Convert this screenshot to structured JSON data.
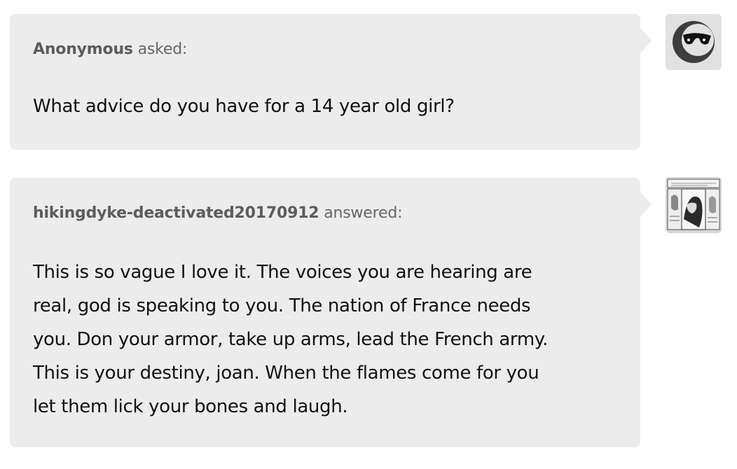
{
  "question": {
    "asker_name": "Anonymous",
    "asker_verb": " asked:",
    "text": "What advice do you have for a 14 year old girl?",
    "avatar_icon": "sunglasses-face-icon"
  },
  "answer": {
    "answerer_name": "hikingdyke-deactivated20170912",
    "answerer_verb": " answered:",
    "lines": [
      "This is so vague I love it. The voices you are hearing are",
      "real, god is speaking to you. The nation of France needs",
      "you. Don your armor, take up arms, lead the French army.",
      "This is your destiny, joan. When the flames come for you",
      "let them lick your bones and laugh."
    ],
    "avatar_icon": "comic-art-avatar"
  },
  "colors": {
    "bubble_background": "#ececec",
    "name_text": "#5c5c5c",
    "body_text": "#111111"
  }
}
